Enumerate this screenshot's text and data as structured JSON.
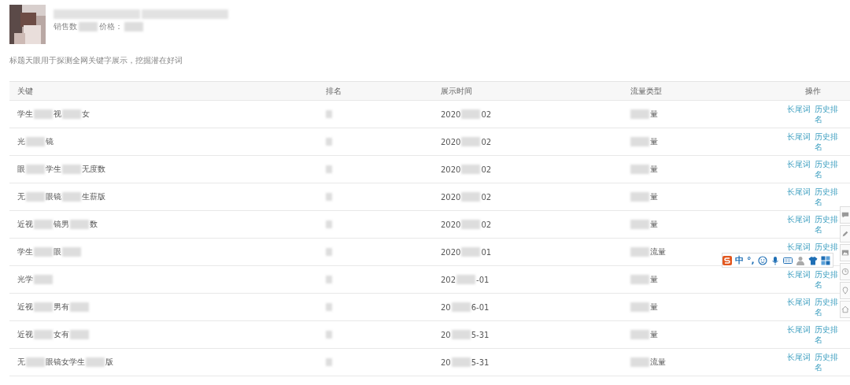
{
  "product": {
    "title": [
      {
        "kind": "blur"
      },
      {
        "kind": "blur"
      }
    ],
    "meta": [
      {
        "kind": "text",
        "text": "销售数"
      },
      {
        "kind": "blur"
      },
      {
        "kind": "text",
        "text": "价格："
      },
      {
        "kind": "blur"
      }
    ]
  },
  "description": "标题天眼用于探测全网关键字展示，挖掘潜在好词",
  "table": {
    "columns": [
      "关键",
      "排名",
      "展示时间",
      "流量类型",
      "操作"
    ],
    "rows": [
      {
        "keyword": [
          {
            "kind": "text",
            "text": "学生"
          },
          {
            "kind": "blur"
          },
          {
            "kind": "text",
            "text": "视"
          },
          {
            "kind": "blur"
          },
          {
            "kind": "text",
            "text": "女"
          }
        ],
        "date": [
          {
            "kind": "text",
            "text": "2020"
          },
          {
            "kind": "blur"
          },
          {
            "kind": "text",
            "text": "02"
          }
        ],
        "traffic": [
          {
            "kind": "blur"
          },
          {
            "kind": "text",
            "text": "量"
          }
        ],
        "actions": [
          "长尾词",
          "历史排名"
        ]
      },
      {
        "keyword": [
          {
            "kind": "text",
            "text": "光"
          },
          {
            "kind": "blur"
          },
          {
            "kind": "text",
            "text": "镜"
          }
        ],
        "date": [
          {
            "kind": "text",
            "text": "2020"
          },
          {
            "kind": "blur"
          },
          {
            "kind": "text",
            "text": "02"
          }
        ],
        "traffic": [
          {
            "kind": "blur"
          },
          {
            "kind": "text",
            "text": "量"
          }
        ],
        "actions": [
          "长尾词",
          "历史排名"
        ]
      },
      {
        "keyword": [
          {
            "kind": "text",
            "text": "眼"
          },
          {
            "kind": "blur"
          },
          {
            "kind": "text",
            "text": "学生"
          },
          {
            "kind": "blur"
          },
          {
            "kind": "text",
            "text": "无度数"
          }
        ],
        "date": [
          {
            "kind": "text",
            "text": "2020"
          },
          {
            "kind": "blur"
          },
          {
            "kind": "text",
            "text": "02"
          }
        ],
        "traffic": [
          {
            "kind": "blur"
          },
          {
            "kind": "text",
            "text": "量"
          }
        ],
        "actions": [
          "长尾词",
          "历史排名"
        ]
      },
      {
        "keyword": [
          {
            "kind": "text",
            "text": "无"
          },
          {
            "kind": "blur"
          },
          {
            "kind": "text",
            "text": "眼镜"
          },
          {
            "kind": "blur"
          },
          {
            "kind": "text",
            "text": "生薪版"
          }
        ],
        "date": [
          {
            "kind": "text",
            "text": "2020"
          },
          {
            "kind": "blur"
          },
          {
            "kind": "text",
            "text": "02"
          }
        ],
        "traffic": [
          {
            "kind": "blur"
          },
          {
            "kind": "text",
            "text": "量"
          }
        ],
        "actions": [
          "长尾词",
          "历史排名"
        ]
      },
      {
        "keyword": [
          {
            "kind": "text",
            "text": "近视"
          },
          {
            "kind": "blur"
          },
          {
            "kind": "text",
            "text": "镜男"
          },
          {
            "kind": "blur"
          },
          {
            "kind": "text",
            "text": "数"
          }
        ],
        "date": [
          {
            "kind": "text",
            "text": "2020"
          },
          {
            "kind": "blur"
          },
          {
            "kind": "text",
            "text": "02"
          }
        ],
        "traffic": [
          {
            "kind": "blur"
          },
          {
            "kind": "text",
            "text": "量"
          }
        ],
        "actions": [
          "长尾词",
          "历史排名"
        ]
      },
      {
        "keyword": [
          {
            "kind": "text",
            "text": "学生"
          },
          {
            "kind": "blur"
          },
          {
            "kind": "text",
            "text": "眼"
          },
          {
            "kind": "blur"
          }
        ],
        "date": [
          {
            "kind": "text",
            "text": "2020"
          },
          {
            "kind": "blur"
          },
          {
            "kind": "text",
            "text": "01"
          }
        ],
        "traffic": [
          {
            "kind": "blur"
          },
          {
            "kind": "text",
            "text": "流量"
          }
        ],
        "actions": [
          "长尾词",
          "历史排"
        ]
      },
      {
        "keyword": [
          {
            "kind": "text",
            "text": "光学"
          },
          {
            "kind": "blur"
          }
        ],
        "date": [
          {
            "kind": "text",
            "text": "202"
          },
          {
            "kind": "blur"
          },
          {
            "kind": "text",
            "text": "-01"
          }
        ],
        "traffic": [
          {
            "kind": "blur"
          },
          {
            "kind": "text",
            "text": "量"
          }
        ],
        "actions": [
          "长尾词",
          "历史排名"
        ]
      },
      {
        "keyword": [
          {
            "kind": "text",
            "text": "近视"
          },
          {
            "kind": "blur"
          },
          {
            "kind": "text",
            "text": "男有"
          },
          {
            "kind": "blur"
          }
        ],
        "date": [
          {
            "kind": "text",
            "text": "20"
          },
          {
            "kind": "blur"
          },
          {
            "kind": "text",
            "text": "6-01"
          }
        ],
        "traffic": [
          {
            "kind": "blur"
          },
          {
            "kind": "text",
            "text": "量"
          }
        ],
        "actions": [
          "长尾词",
          "历史排名"
        ]
      },
      {
        "keyword": [
          {
            "kind": "text",
            "text": "近视"
          },
          {
            "kind": "blur"
          },
          {
            "kind": "text",
            "text": "女有"
          },
          {
            "kind": "blur"
          }
        ],
        "date": [
          {
            "kind": "text",
            "text": "20"
          },
          {
            "kind": "blur"
          },
          {
            "kind": "text",
            "text": "5-31"
          }
        ],
        "traffic": [
          {
            "kind": "blur"
          },
          {
            "kind": "text",
            "text": "量"
          }
        ],
        "actions": [
          "长尾词",
          "历史排名"
        ]
      },
      {
        "keyword": [
          {
            "kind": "text",
            "text": "无"
          },
          {
            "kind": "blur"
          },
          {
            "kind": "text",
            "text": "眼镜女学生"
          },
          {
            "kind": "blur"
          },
          {
            "kind": "text",
            "text": "版"
          }
        ],
        "date": [
          {
            "kind": "text",
            "text": "20"
          },
          {
            "kind": "blur"
          },
          {
            "kind": "text",
            "text": "5-31"
          }
        ],
        "traffic": [
          {
            "kind": "blur"
          },
          {
            "kind": "text",
            "text": "流量"
          }
        ],
        "actions": [
          "长尾词",
          "历史排名"
        ]
      }
    ]
  },
  "ime_toolbar": {
    "mode": "中",
    "punctuation": "°,"
  }
}
